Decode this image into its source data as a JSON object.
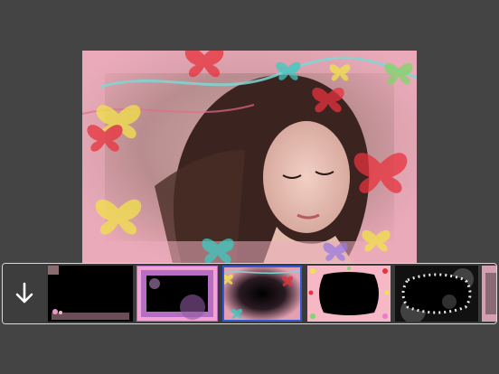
{
  "editor": {
    "photo_icon": "photo-butterfly-frame",
    "colors": {
      "background": "#444444",
      "frame_pink": "#e8a7b6",
      "selected_border": "#3457d6"
    }
  },
  "frame_strip": {
    "download_icon": "arrow-down-icon",
    "selected_index": 2,
    "frames": [
      {
        "id": "frame-1",
        "style": "black-ribbon"
      },
      {
        "id": "frame-2",
        "style": "pink-purple-border"
      },
      {
        "id": "frame-3",
        "style": "butterfly"
      },
      {
        "id": "frame-4",
        "style": "flower-label"
      },
      {
        "id": "frame-5",
        "style": "pearl-bokeh"
      },
      {
        "id": "frame-6",
        "style": "partial"
      }
    ]
  }
}
